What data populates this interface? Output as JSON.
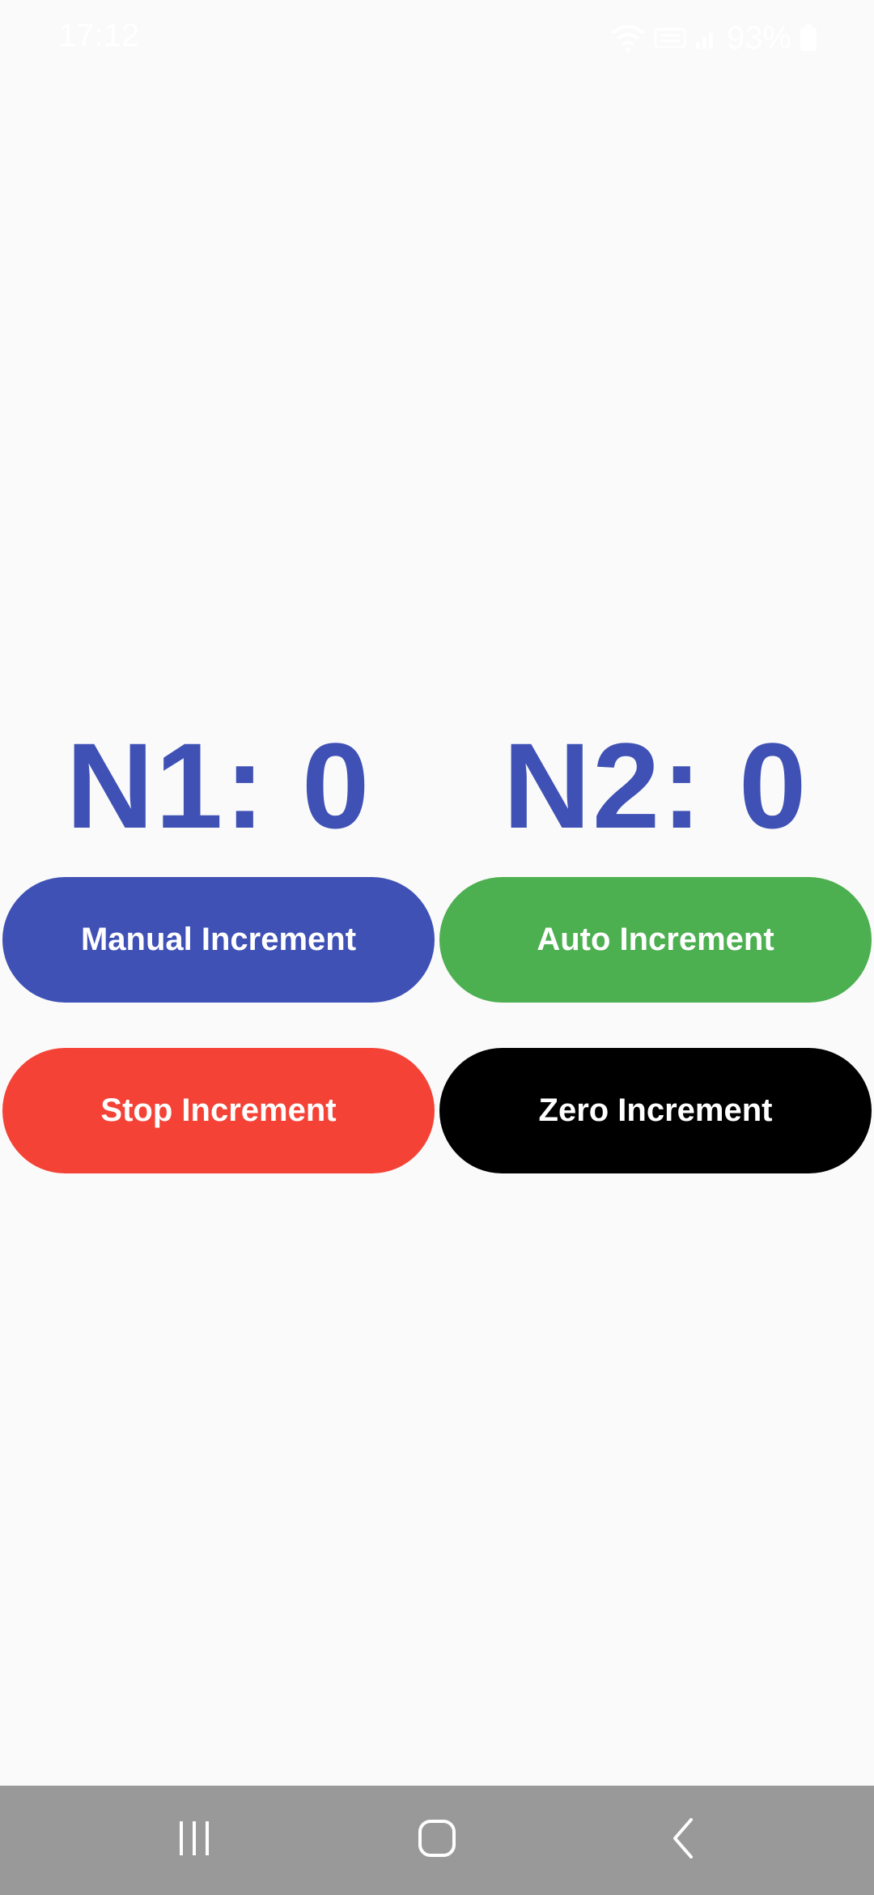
{
  "status_bar": {
    "time": "17:12",
    "battery": "93%",
    "icons": [
      "wifi-icon",
      "volte-icon",
      "signal-icon",
      "battery-icon"
    ]
  },
  "counters": {
    "n1": "N1: 0",
    "n2": "N2: 0"
  },
  "buttons": {
    "manual": "Manual Increment",
    "auto": "Auto Increment",
    "stop": "Stop Increment",
    "zero": "Zero Increment"
  },
  "colors": {
    "background": "#fafafa",
    "counter_text": "#3f51b5",
    "manual_button": "#3f51b5",
    "auto_button": "#4caf50",
    "stop_button": "#f44336",
    "zero_button": "#000000",
    "nav_bar": "#999999"
  },
  "nav_bar": {
    "icons": [
      "recents-icon",
      "home-icon",
      "back-icon"
    ]
  }
}
